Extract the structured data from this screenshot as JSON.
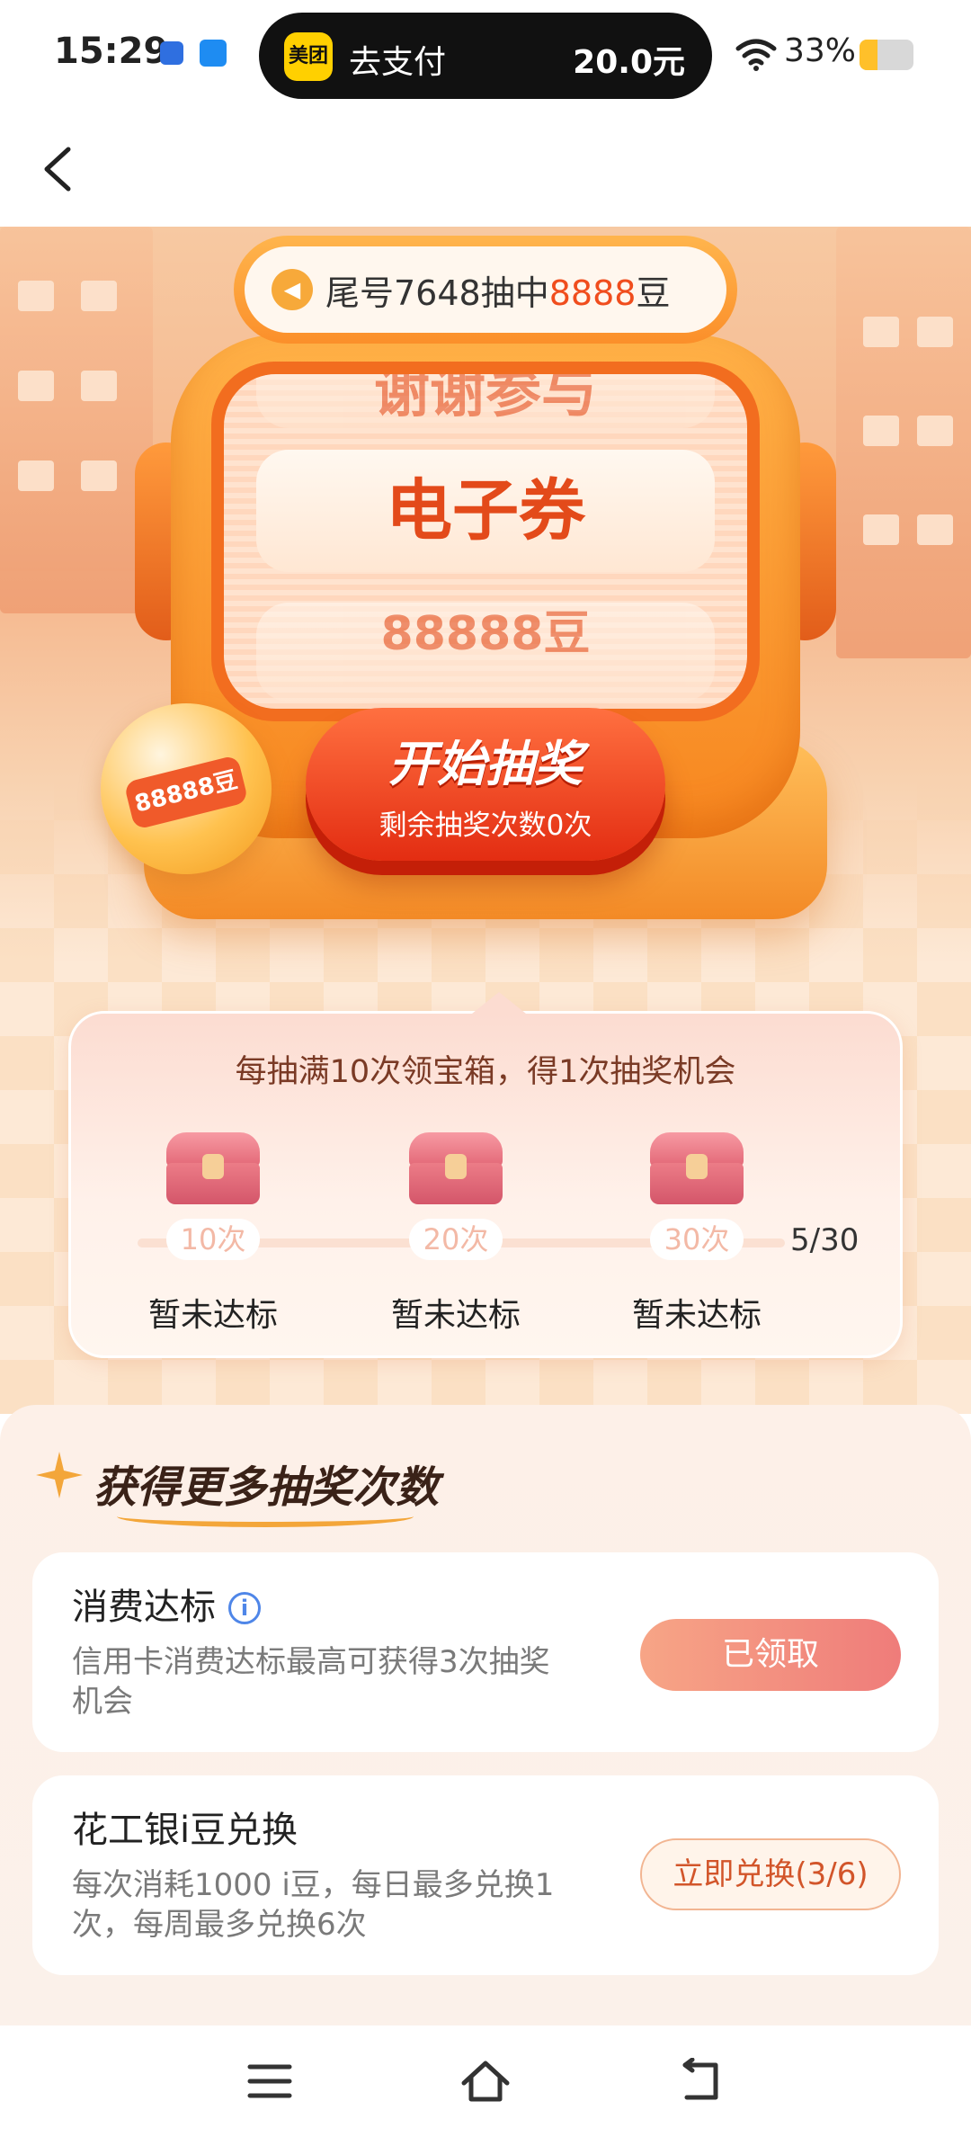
{
  "status_bar": {
    "time": "15:29",
    "pill_brand": "美团",
    "pill_action": "去支付",
    "pill_amount": "20.0元",
    "battery_text": "33%",
    "battery_level": 0.33,
    "battery_color": "#ffc02a",
    "icons": [
      "message-icon",
      "app-icon",
      "wifi-icon",
      "battery-icon"
    ]
  },
  "nav": {
    "back_icon": "back-arrow-icon"
  },
  "machine": {
    "notice_prefix": "尾号7648抽中",
    "notice_highlight": "8888",
    "notice_suffix": "豆",
    "slot_top": "谢谢参与",
    "slot_middle": "电子券",
    "slot_bottom": "88888豆",
    "ball_label": "88888豆",
    "draw_button_label": "开始抽奖",
    "draw_button_sub": "剩余抽奖次数0次",
    "accent_color": "#e32d12"
  },
  "progress": {
    "title": "每抽满10次领宝箱，得1次抽奖机会",
    "count": "5/30",
    "value": 5,
    "max": 30,
    "milestones": [
      {
        "label": "10次",
        "status": "暂未达标"
      },
      {
        "label": "20次",
        "status": "暂未达标"
      },
      {
        "label": "30次",
        "status": "暂未达标"
      }
    ]
  },
  "tasks": {
    "section_title": "获得更多抽奖次数",
    "items": [
      {
        "name": "消费达标",
        "desc": "信用卡消费达标最高可获得3次抽奖机会",
        "button": "已领取"
      },
      {
        "name": "花工银i豆兑换",
        "desc": "每次消耗1000 i豆，每日最多兑换1次，每周最多兑换6次",
        "button": "立即兑换(3/6)"
      }
    ]
  },
  "navbar": {
    "icons": [
      "menu-icon",
      "home-icon",
      "back-icon"
    ]
  }
}
